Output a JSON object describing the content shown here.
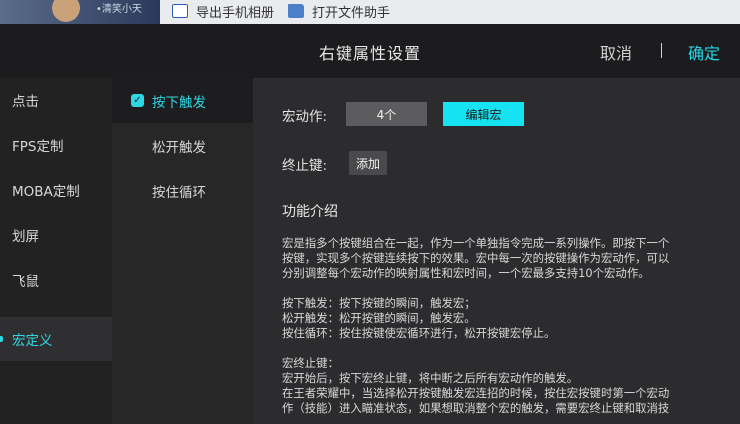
{
  "background_window": {
    "user_name": "•清笑小天",
    "export_label": "导出手机相册",
    "open_label": "打开文件助手"
  },
  "header": {
    "title": "右键属性设置",
    "cancel": "取消",
    "confirm": "确定"
  },
  "menu": {
    "items": [
      {
        "label": "点击"
      },
      {
        "label": "FPS定制"
      },
      {
        "label": "MOBA定制"
      },
      {
        "label": "划屏"
      },
      {
        "label": "飞鼠"
      },
      {
        "label": "宏定义"
      }
    ],
    "active_index": 5
  },
  "submenu": {
    "items": [
      {
        "label": "按下触发"
      },
      {
        "label": "松开触发"
      },
      {
        "label": "按住循环"
      }
    ],
    "active_index": 0
  },
  "content": {
    "macro_label": "宏动作:",
    "macro_count": "4个",
    "edit_macro": "编辑宏",
    "stop_key_label": "终止键:",
    "add_button": "添加",
    "intro_title": "功能介绍",
    "intro_p1": [
      "宏是指多个按键组合在一起，作为一个单独指令完成一系列操作。即按下一个",
      "按键，实现多个按键连续按下的效果。宏中每一次的按键操作为宏动作，可以",
      "分别调整每个宏动作的映射属性和宏时间，一个宏最多支持10个宏动作。"
    ],
    "intro_p2": [
      "按下触发：按下按键的瞬间，触发宏；",
      "松开触发：松开按键的瞬间，触发宏。",
      "按住循环：按住按键使宏循环进行，松开按键宏停止。"
    ],
    "intro_p3": [
      "宏终止键：",
      "宏开始后，按下宏终止键，将中断之后所有宏动作的触发。",
      "在王者荣耀中，当选择松开按键触发宏连招的时候，按住宏按键时第一个宏动",
      "作（技能）进入瞄准状态，如果想取消整个宏的触发，需要宏终止键和取消技"
    ]
  },
  "colors": {
    "accent": "#2fd6e3",
    "button_accent": "#16e3f1",
    "header_bg": "#1c1c1e",
    "panel_bg": "#2c2c2e"
  }
}
